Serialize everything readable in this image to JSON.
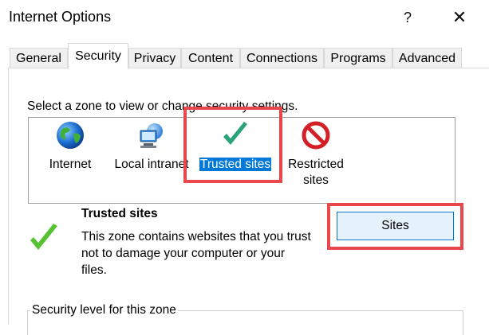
{
  "window": {
    "title": "Internet Options",
    "help_glyph": "?",
    "close_glyph": "✕"
  },
  "tabs": [
    {
      "label": "General"
    },
    {
      "label": "Security"
    },
    {
      "label": "Privacy"
    },
    {
      "label": "Content"
    },
    {
      "label": "Connections"
    },
    {
      "label": "Programs"
    },
    {
      "label": "Advanced"
    }
  ],
  "security": {
    "zone_prompt": "Select a zone to view or change security settings.",
    "zones": [
      {
        "label": "Internet",
        "icon": "globe-icon"
      },
      {
        "label": "Local intranet",
        "icon": "intranet-icon"
      },
      {
        "label": "Trusted sites",
        "icon": "checkmark-icon"
      },
      {
        "label": "Restricted",
        "label2": "sites",
        "icon": "restricted-icon"
      }
    ],
    "selected_zone": "Trusted sites",
    "description_title": "Trusted sites",
    "description_text": "This zone contains websites that you trust not to damage your computer or your files.",
    "sites_button": "Sites",
    "level_group_label": "Security level for this zone"
  },
  "colors": {
    "highlight": "#e8474b",
    "selection": "#0078d7",
    "button_bg": "#e5f1fb"
  }
}
